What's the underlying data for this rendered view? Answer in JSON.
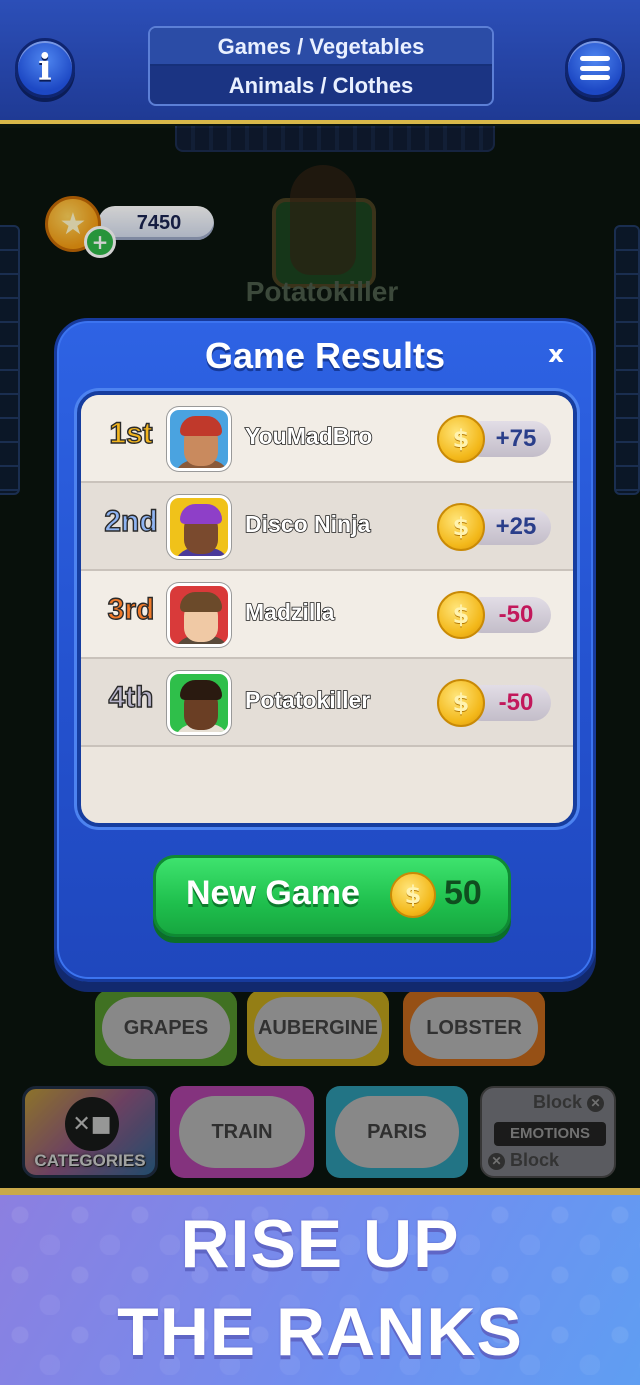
{
  "header": {
    "categories": [
      "Games / Vegetables",
      "Animals / Clothes"
    ],
    "info_icon": "info-icon",
    "menu_icon": "hamburger-menu-icon"
  },
  "wallet": {
    "coins": "7450",
    "coin_icon": "star-coin-icon",
    "add_icon": "plus-icon"
  },
  "background": {
    "current_player": "Potatokiller",
    "word_cards": [
      "GRAPES",
      "AUBERGINE",
      "LOBSTER"
    ],
    "hand_cards": [
      "TRAIN",
      "PARIS"
    ],
    "categories_label": "CATEGORIES",
    "block_label": "Block",
    "emotions_label": "EMOTIONS"
  },
  "modal": {
    "title": "Game Results",
    "close_label": "x",
    "results": [
      {
        "rank": "1st",
        "name": "YouMadBro",
        "score": "+75",
        "rank_color": "#f2b51f",
        "score_color": "#2a3e8a",
        "avatar_bg": "#4aa3e0",
        "skin": "#c98a5e",
        "hair": "#c0392b",
        "shirt": "#8a5a3a"
      },
      {
        "rank": "2nd",
        "name": "Disco Ninja",
        "score": "+25",
        "rank_color": "#8fb4f2",
        "score_color": "#2a3e8a",
        "avatar_bg": "#f0c21a",
        "skin": "#7a4a2e",
        "hair": "#8e3fc8",
        "shirt": "#4a3a9a"
      },
      {
        "rank": "3rd",
        "name": "Madzilla",
        "score": "-50",
        "rank_color": "#f07a2a",
        "score_color": "#c2185b",
        "avatar_bg": "#d93a3a",
        "skin": "#f0c9a5",
        "hair": "#6b4a2a",
        "shirt": "#5a4a3a"
      },
      {
        "rank": "4th",
        "name": "Potatokiller",
        "score": "-50",
        "rank_color": "#b7b3c9",
        "score_color": "#c2185b",
        "avatar_bg": "#2fbf4a",
        "skin": "#6a3e24",
        "hair": "#2a1a10",
        "shirt": "#e6dfd3"
      }
    ],
    "coin_icon": "dollar-coin-icon",
    "new_game_label": "New Game",
    "new_game_cost": "50"
  },
  "promo": {
    "line1": "RISE UP",
    "line2": "THE RANKS"
  }
}
